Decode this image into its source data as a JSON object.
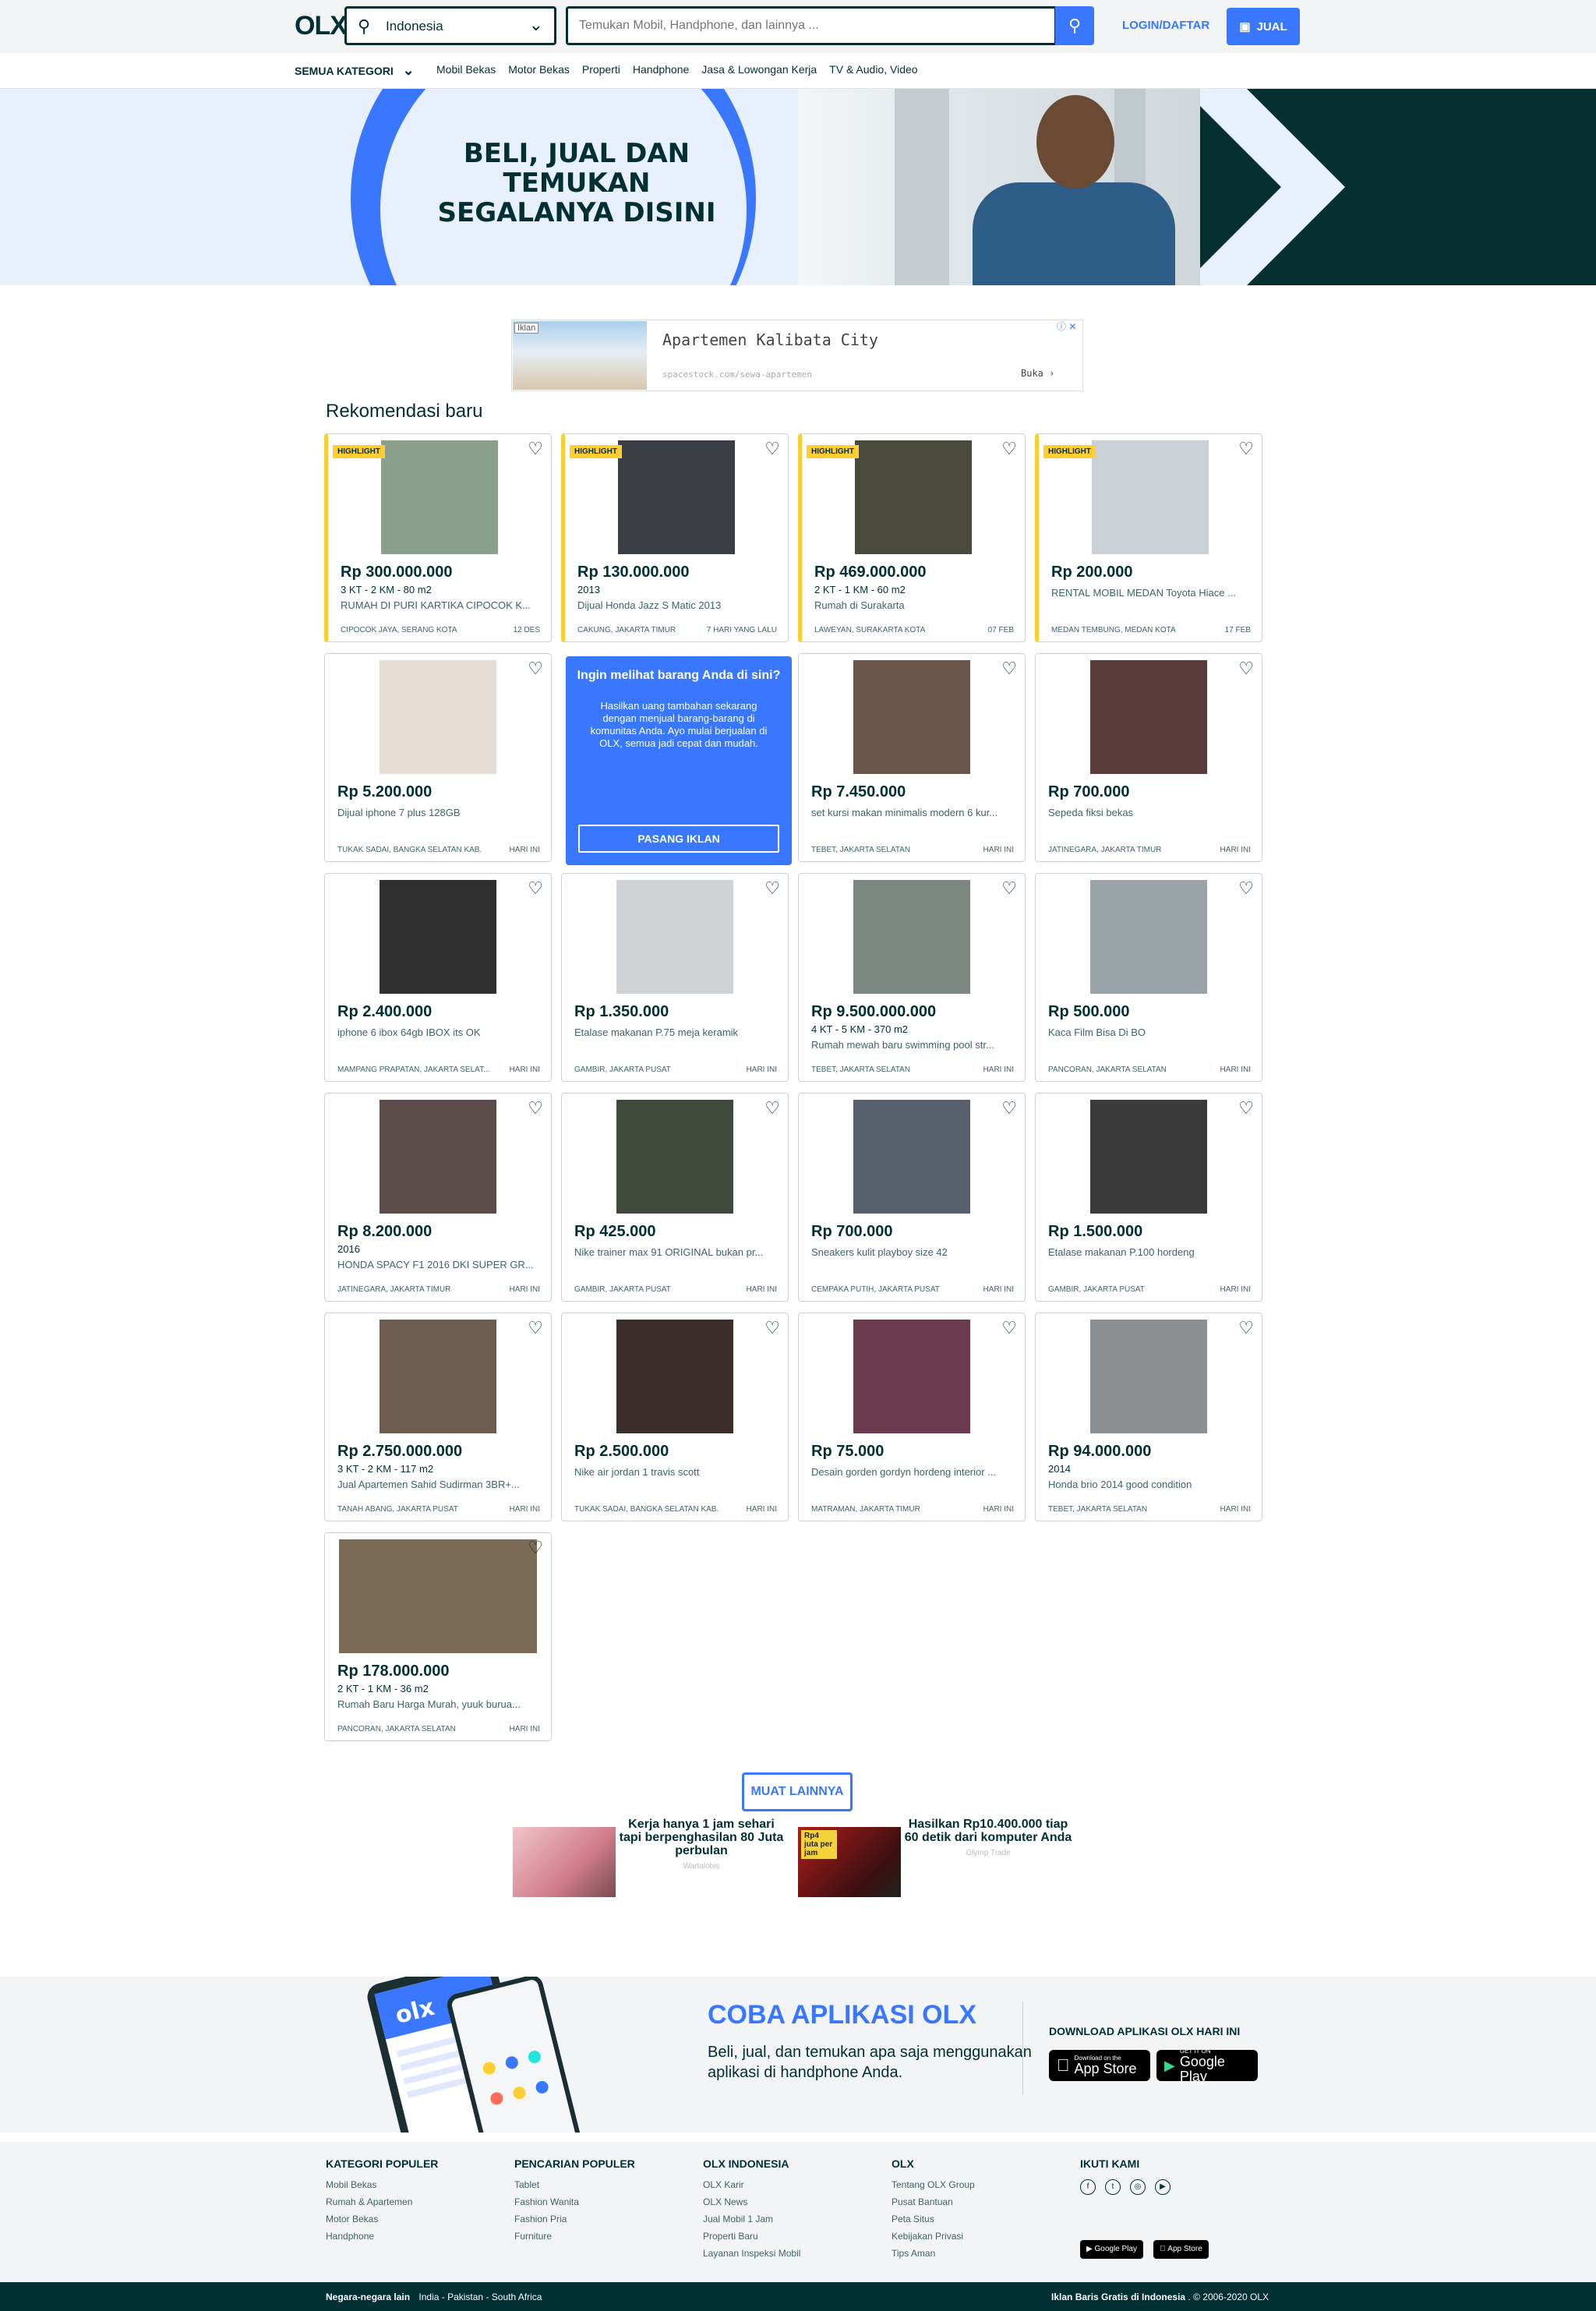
{
  "header": {
    "logo": "OLX",
    "location_value": "Indonesia",
    "search_placeholder": "Temukan Mobil, Handphone, dan lainnya ...",
    "login_label": "LOGIN/DAFTAR",
    "sell_label": "JUAL"
  },
  "categories": {
    "all_label": "SEMUA KATEGORI",
    "items": [
      "Mobil Bekas",
      "Motor Bekas",
      "Properti",
      "Handphone",
      "Jasa & Lowongan Kerja",
      "TV & Audio, Video"
    ]
  },
  "hero": {
    "headline": "BELI, JUAL DAN TEMUKAN SEGALANYA DISINI"
  },
  "ad": {
    "tag": "Iklan",
    "title": "Apartemen Kalibata City",
    "url": "spacestock.com/sewa-apartemen",
    "open_label": "Buka ›",
    "close": "ⓘ ✕"
  },
  "section_title": "Rekomendasi baru",
  "highlight_label": "HIGHLIGHT",
  "listings": [
    {
      "price": "Rp 300.000.000",
      "details": "3 KT - 2 KM - 80 m2",
      "title": "RUMAH DI PURI KARTIKA CIPOCOK K...",
      "location": "CIPOCOK JAYA, SERANG KOTA",
      "date": "12 DES",
      "highlight": true,
      "thumb": "#8aa08a"
    },
    {
      "price": "Rp 130.000.000",
      "details": "2013",
      "title": "Dijual Honda Jazz S Matic 2013",
      "location": "CAKUNG, JAKARTA TIMUR",
      "date": "7 HARI YANG LALU",
      "highlight": true,
      "thumb": "#3b3e44"
    },
    {
      "price": "Rp 469.000.000",
      "details": "2 KT - 1 KM - 60 m2",
      "title": "Rumah di Surakarta",
      "location": "LAWEYAN, SURAKARTA KOTA",
      "date": "07 FEB",
      "highlight": true,
      "thumb": "#4a4a3a"
    },
    {
      "price": "Rp 200.000",
      "details": "",
      "title": "RENTAL MOBIL MEDAN Toyota Hiace ...",
      "location": "MEDAN TEMBUNG, MEDAN KOTA",
      "date": "17 FEB",
      "highlight": true,
      "thumb": "#c9d0d6"
    },
    {
      "price": "Rp 5.200.000",
      "details": "",
      "title": "Dijual iphone 7 plus 128GB",
      "location": "TUKAK SADAI, BANGKA SELATAN KAB.",
      "date": "HARI INI",
      "highlight": false,
      "thumb": "#e6ddd4"
    },
    {
      "price": "Rp 7.450.000",
      "details": "",
      "title": "set kursi makan minimalis modern 6 kur...",
      "location": "TEBET, JAKARTA SELATAN",
      "date": "HARI INI",
      "highlight": false,
      "thumb": "#6a5648"
    },
    {
      "price": "Rp 700.000",
      "details": "",
      "title": "Sepeda fiksi bekas",
      "location": "JATINEGARA, JAKARTA TIMUR",
      "date": "HARI INI",
      "highlight": false,
      "thumb": "#5a3b3b"
    },
    {
      "price": "Rp 2.400.000",
      "details": "",
      "title": "iphone 6 ibox 64gb IBOX its OK",
      "location": "MAMPANG PRAPATAN, JAKARTA SELAT...",
      "date": "HARI INI",
      "highlight": false,
      "thumb": "#2f2f2f"
    },
    {
      "price": "Rp 1.350.000",
      "details": "",
      "title": "Etalase makanan P.75 meja keramik",
      "location": "GAMBIR, JAKARTA PUSAT",
      "date": "HARI INI",
      "highlight": false,
      "thumb": "#cfd3d6"
    },
    {
      "price": "Rp 9.500.000.000",
      "details": "4 KT - 5 KM - 370 m2",
      "title": "Rumah mewah baru swimming pool str...",
      "location": "TEBET, JAKARTA SELATAN",
      "date": "HARI INI",
      "highlight": false,
      "thumb": "#7d8782"
    },
    {
      "price": "Rp 500.000",
      "details": "",
      "title": "Kaca Film Bisa Di BO",
      "location": "PANCORAN, JAKARTA SELATAN",
      "date": "HARI INI",
      "highlight": false,
      "thumb": "#9aa3a8"
    },
    {
      "price": "Rp 8.200.000",
      "details": "2016",
      "title": "HONDA SPACY F1 2016 DKI SUPER GR...",
      "location": "JATINEGARA, JAKARTA TIMUR",
      "date": "HARI INI",
      "highlight": false,
      "thumb": "#5b4b4b"
    },
    {
      "price": "Rp 425.000",
      "details": "",
      "title": "Nike trainer max 91 ORIGINAL bukan pr...",
      "location": "GAMBIR, JAKARTA PUSAT",
      "date": "HARI INI",
      "highlight": false,
      "thumb": "#3f4a3c"
    },
    {
      "price": "Rp 700.000",
      "details": "",
      "title": "Sneakers kulit playboy size 42",
      "location": "CEMPAKA PUTIH, JAKARTA PUSAT",
      "date": "HARI INI",
      "highlight": false,
      "thumb": "#58606e"
    },
    {
      "price": "Rp 1.500.000",
      "details": "",
      "title": "Etalase makanan P.100 hordeng",
      "location": "GAMBIR, JAKARTA PUSAT",
      "date": "HARI INI",
      "highlight": false,
      "thumb": "#3a3a3a"
    },
    {
      "price": "Rp 2.750.000.000",
      "details": "3 KT - 2 KM - 117 m2",
      "title": "Jual Apartemen Sahid Sudirman 3BR+...",
      "location": "TANAH ABANG, JAKARTA PUSAT",
      "date": "HARI INI",
      "highlight": false,
      "thumb": "#6e5d4e"
    },
    {
      "price": "Rp 2.500.000",
      "details": "",
      "title": "Nike air jordan 1 travis scott",
      "location": "TUKAK SADAI, BANGKA SELATAN KAB.",
      "date": "HARI INI",
      "highlight": false,
      "thumb": "#3b2e2a"
    },
    {
      "price": "Rp 75.000",
      "details": "",
      "title": "Desain gorden gordyn hordeng interior ...",
      "location": "MATRAMAN, JAKARTA TIMUR",
      "date": "HARI INI",
      "highlight": false,
      "thumb": "#6b3b4e"
    },
    {
      "price": "Rp 94.000.000",
      "details": "2014",
      "title": "Honda brio 2014 good condition",
      "location": "TEBET, JAKARTA SELATAN",
      "date": "HARI INI",
      "highlight": false,
      "thumb": "#8c8f92"
    },
    {
      "price": "Rp 178.000.000",
      "details": "2 KT - 1 KM - 36 m2",
      "title": "Rumah Baru Harga Murah, yuuk burua...",
      "location": "PANCORAN, JAKARTA SELATAN",
      "date": "HARI INI",
      "highlight": false,
      "thumb": "#7b6a55"
    }
  ],
  "promo": {
    "heading": "Ingin melihat barang Anda di sini?",
    "text": "Hasilkan uang tambahan sekarang dengan menjual barang-barang di komunitas Anda. Ayo mulai berjualan di OLX, semua jadi cepat dan mudah.",
    "button": "PASANG IKLAN"
  },
  "load_more": "MUAT LAINNYA",
  "sponsored": [
    {
      "title": "Kerja hanya 1 jam sehari tapi berpenghasilan 80 Juta perbulan",
      "source": "Wartalobis"
    },
    {
      "title": "Hasilkan Rp10.400.000 tiap 60 detik dari komputer Anda",
      "source": "Olymp Trade",
      "img_label": "Rp4 juta per jam"
    }
  ],
  "app_section": {
    "title": "COBA APLIKASI OLX",
    "subtitle": "Beli, jual, dan temukan apa saja menggunakan aplikasi di handphone Anda.",
    "download_title": "DOWNLOAD APLIKASI OLX HARI INI",
    "appstore_small": "Download on the",
    "appstore_big": "App Store",
    "gplay_small": "GET IT ON",
    "gplay_big": "Google Play"
  },
  "footer": {
    "columns": [
      {
        "title": "KATEGORI POPULER",
        "items": [
          "Mobil Bekas",
          "Rumah & Apartemen",
          "Motor Bekas",
          "Handphone"
        ]
      },
      {
        "title": "PENCARIAN POPULER",
        "items": [
          "Tablet",
          "Fashion Wanita",
          "Fashion Pria",
          "Furniture"
        ]
      },
      {
        "title": "OLX INDONESIA",
        "items": [
          "OLX Karir",
          "OLX News",
          "Jual Mobil 1 Jam",
          "Properti Baru",
          "Layanan Inspeksi Mobil"
        ]
      },
      {
        "title": "OLX",
        "items": [
          "Tentang OLX Group",
          "Pusat Bantuan",
          "Peta Situs",
          "Kebijakan Privasi",
          "Tips Aman"
        ]
      }
    ],
    "follow_title": "IKUTI KAMI",
    "mini_gplay": "Google Play",
    "mini_appstore": "App Store"
  },
  "bottom_bar": {
    "other_label": "Negara-negara lain",
    "countries": "India - Pakistan - South Africa",
    "right_bold": "Iklan Baris Gratis di Indonesia",
    "right_copy": ". © 2006-2020 OLX"
  },
  "colors": {
    "brand_dark": "#002f34",
    "accent_blue": "#3a77ff",
    "highlight_yellow": "#ffce32"
  }
}
